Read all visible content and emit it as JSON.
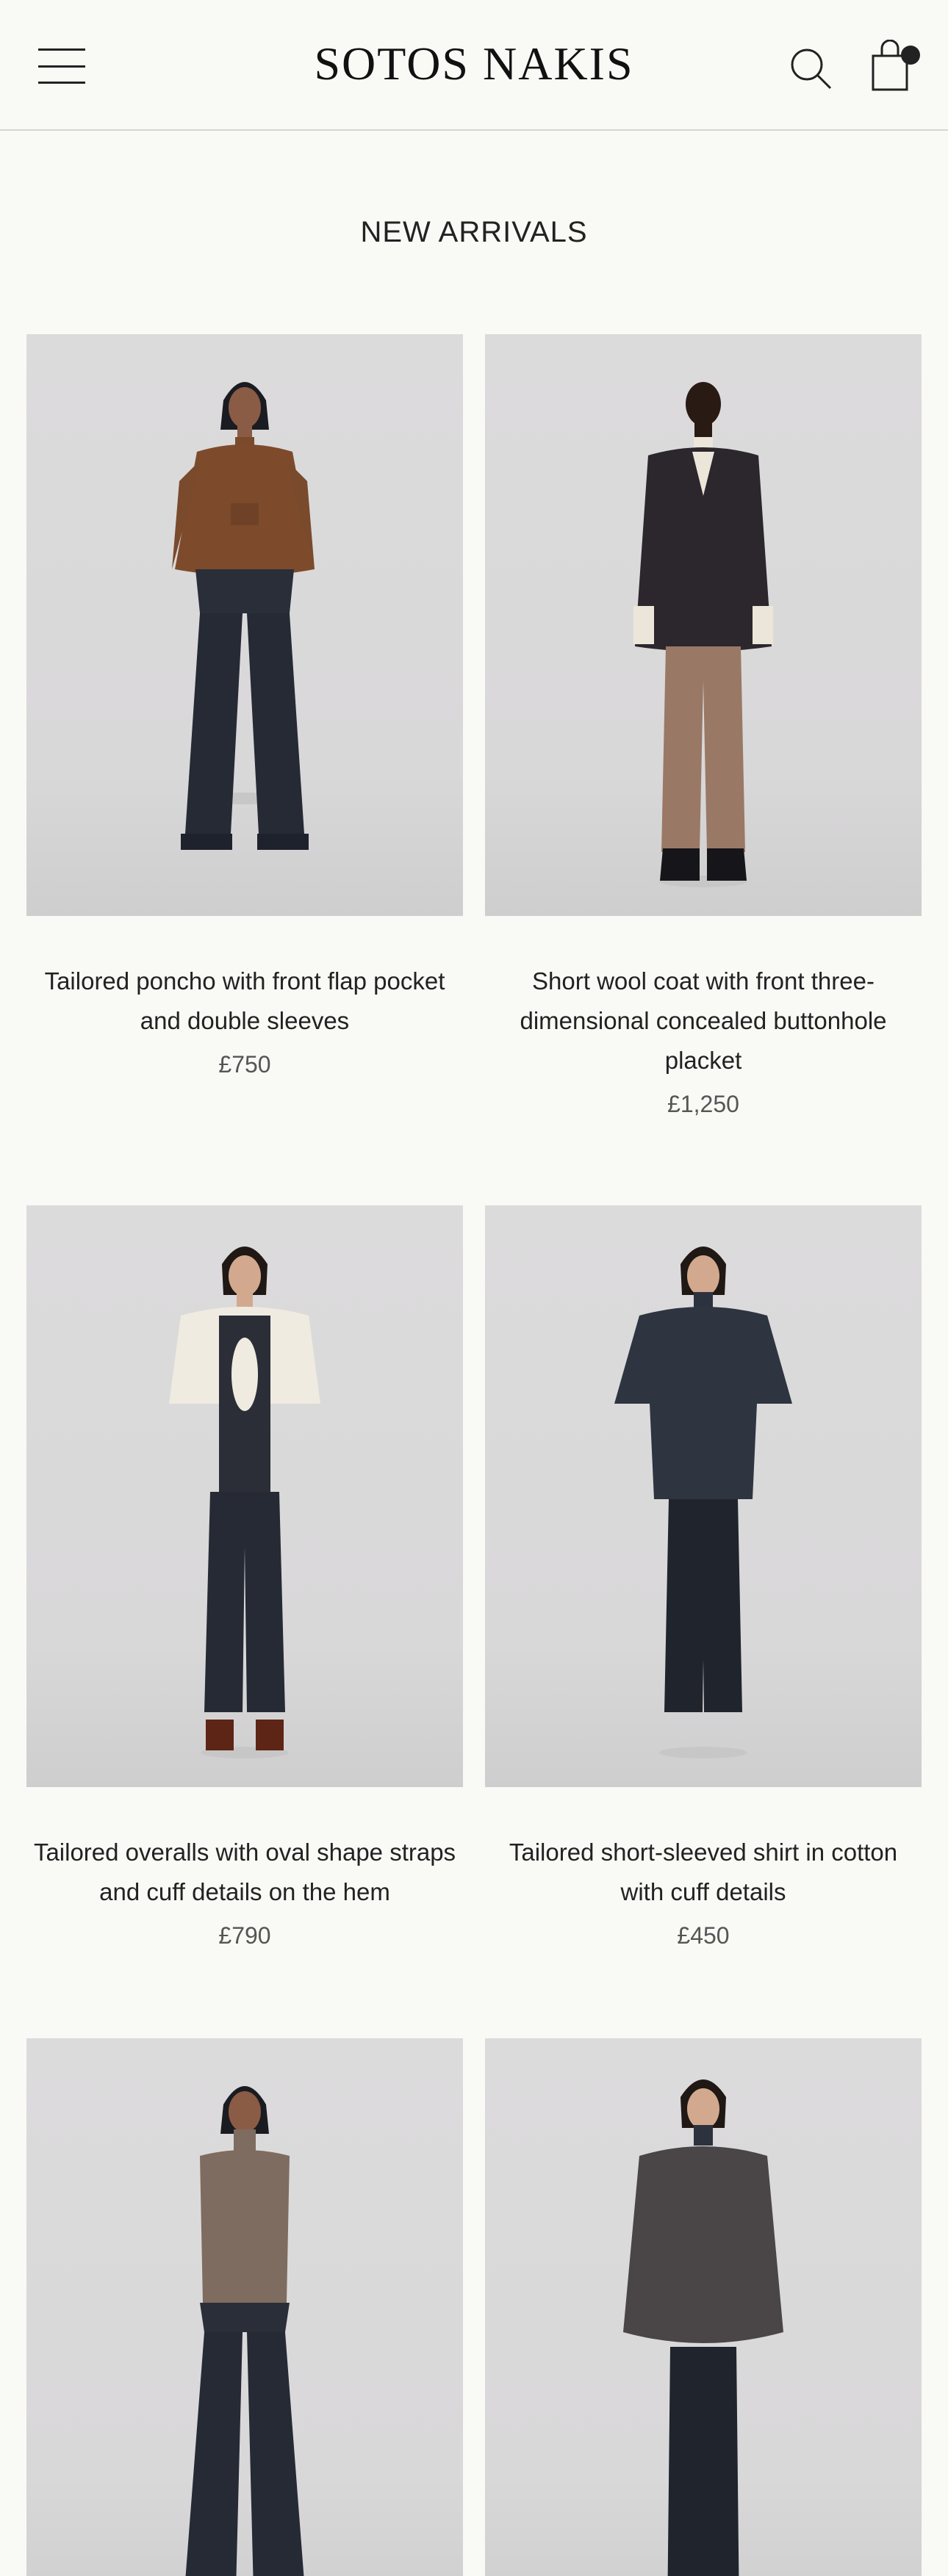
{
  "header": {
    "logo": "SOTOS NAKIS",
    "icons": [
      "menu-icon",
      "search-icon",
      "bag-icon"
    ]
  },
  "section": {
    "title": "NEW ARRIVALS"
  },
  "products": [
    {
      "name": "Tailored poncho with front flap pocket and double sleeves",
      "price": "£750"
    },
    {
      "name": "Short wool coat with front three-dimensional concealed buttonhole placket",
      "price": "£1,250"
    },
    {
      "name": "Tailored overalls with oval shape straps and cuff details on the hem",
      "price": "£790"
    },
    {
      "name": "Tailored short-sleeved shirt in cotton with cuff details",
      "price": "£450"
    },
    {
      "name": "",
      "price": ""
    },
    {
      "name": "",
      "price": ""
    }
  ],
  "colors": {
    "background": "#f9f9f6",
    "photo_background": "#dad9da",
    "text": "#222222",
    "price": "#555555"
  }
}
